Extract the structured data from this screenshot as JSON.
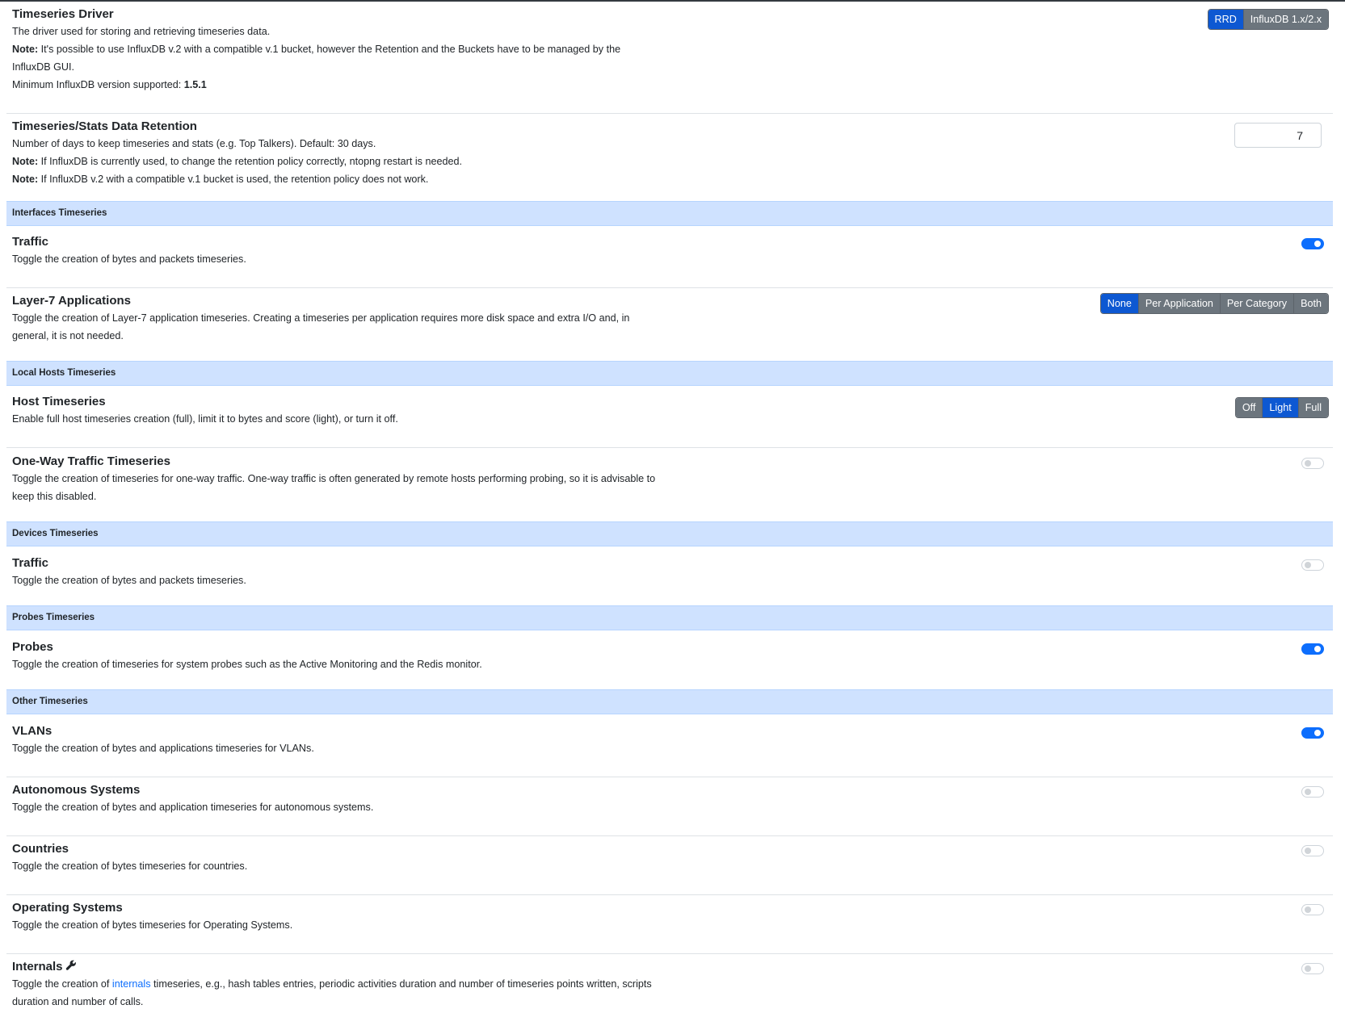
{
  "driver": {
    "title": "Timeseries Driver",
    "desc": "The driver used for storing and retrieving timeseries data.",
    "note_label": "Note:",
    "note_text": " It's possible to use InfluxDB v.2 with a compatible v.1 bucket, however the Retention and the Buckets have to be managed by the InfluxDB GUI.",
    "min_version_text": "Minimum InfluxDB version supported: ",
    "min_version": "1.5.1",
    "options": [
      "RRD",
      "InfluxDB 1.x/2.x"
    ],
    "selected": "RRD"
  },
  "retention": {
    "title": "Timeseries/Stats Data Retention",
    "desc": "Number of days to keep timeseries and stats (e.g. Top Talkers). Default: 30 days.",
    "note1_label": "Note:",
    "note1_text": " If InfluxDB is currently used, to change the retention policy correctly, ntopng restart is needed.",
    "note2_label": "Note:",
    "note2_text": " If InfluxDB v.2 with a compatible v.1 bucket is used, the retention policy does not work.",
    "value": "7"
  },
  "sections": {
    "interfaces": "Interfaces Timeseries",
    "local_hosts": "Local Hosts Timeseries",
    "devices": "Devices Timeseries",
    "probes": "Probes Timeseries",
    "other": "Other Timeseries"
  },
  "iface_traffic": {
    "title": "Traffic",
    "desc": "Toggle the creation of bytes and packets timeseries.",
    "enabled": true
  },
  "l7": {
    "title": "Layer-7 Applications",
    "desc": "Toggle the creation of Layer-7 application timeseries. Creating a timeseries per application requires more disk space and extra I/O and, in general, it is not needed.",
    "options": [
      "None",
      "Per Application",
      "Per Category",
      "Both"
    ],
    "selected": "None"
  },
  "host_ts": {
    "title": "Host Timeseries",
    "desc": "Enable full host timeseries creation (full), limit it to bytes and score (light), or turn it off.",
    "options": [
      "Off",
      "Light",
      "Full"
    ],
    "selected": "Light"
  },
  "one_way": {
    "title": "One-Way Traffic Timeseries",
    "desc": "Toggle the creation of timeseries for one-way traffic. One-way traffic is often generated by remote hosts performing probing, so it is advisable to keep this disabled.",
    "enabled": false
  },
  "dev_traffic": {
    "title": "Traffic",
    "desc": "Toggle the creation of bytes and packets timeseries.",
    "enabled": false
  },
  "probes": {
    "title": "Probes",
    "desc": "Toggle the creation of timeseries for system probes such as the Active Monitoring and the Redis monitor.",
    "enabled": true
  },
  "vlans": {
    "title": "VLANs",
    "desc": "Toggle the creation of bytes and applications timeseries for VLANs.",
    "enabled": true
  },
  "asn": {
    "title": "Autonomous Systems",
    "desc": "Toggle the creation of bytes and application timeseries for autonomous systems.",
    "enabled": false
  },
  "countries": {
    "title": "Countries",
    "desc": "Toggle the creation of bytes timeseries for countries.",
    "enabled": false
  },
  "os": {
    "title": "Operating Systems",
    "desc": "Toggle the creation of bytes timeseries for Operating Systems.",
    "enabled": false
  },
  "internals": {
    "title": "Internals",
    "icon": "wrench-icon",
    "desc_pre": "Toggle the creation of ",
    "desc_link": "internals",
    "desc_post": " timeseries, e.g., hash tables entries, periodic activities duration and number of timeseries points written, scripts duration and number of calls.",
    "enabled": false
  },
  "colors": {
    "accent": "#0d6efd",
    "active_button": "#0d58d2",
    "inactive_button": "#6c757d",
    "section_bg": "#cfe2ff"
  }
}
